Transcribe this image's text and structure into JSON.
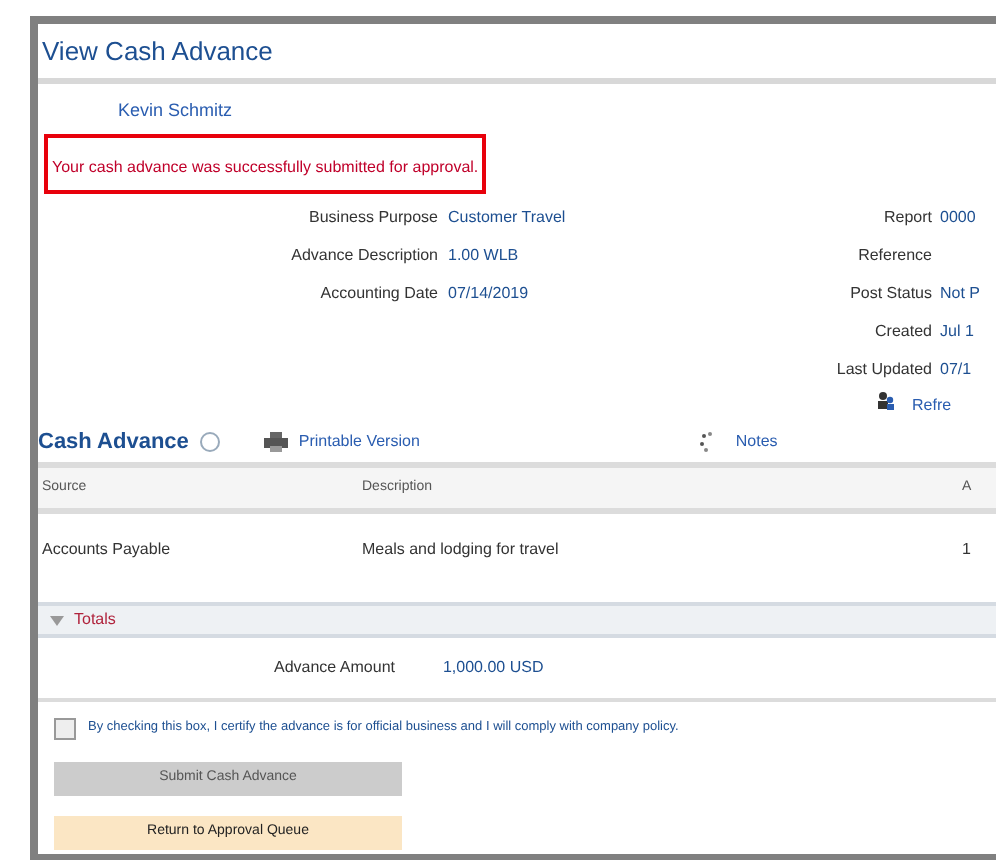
{
  "page_title": "View Cash Advance",
  "employee_link": "Kevin Schmitz",
  "message": "Your cash advance was successfully submitted for approval.",
  "left_fields": [
    {
      "label": "Business Purpose",
      "value": "Customer Travel"
    },
    {
      "label": "Advance Description",
      "value": "1.00 WLB"
    },
    {
      "label": "Accounting Date",
      "value": "07/14/2019"
    }
  ],
  "right_fields": [
    {
      "label": "Report",
      "value": "0000"
    },
    {
      "label": "Reference"
    },
    {
      "label": "Post Status",
      "value": "Not P"
    },
    {
      "label": "Created",
      "value": "Jul 1"
    },
    {
      "label": "Last Updated",
      "value": "07/1"
    }
  ],
  "refresh_link": "Refre",
  "section": {
    "title": "Cash Advance",
    "print_link": "Printable Version",
    "notes_link": "Notes"
  },
  "table": {
    "columns": [
      "Source",
      "Description",
      "A"
    ],
    "rows": [
      [
        "Accounts Payable",
        "Meals and lodging for travel",
        "1"
      ]
    ]
  },
  "totals": {
    "title": "Totals",
    "expanded": true,
    "label": "Advance Amount",
    "value": "1,000.00 USD"
  },
  "certify": {
    "checked": false,
    "text": "By checking this box, I certify the advance is for official business and I will comply with company policy."
  },
  "buttons": [
    {
      "label": "Submit Cash Advance",
      "disabled": true
    },
    {
      "label": "Return to Approval Queue",
      "disabled": false
    }
  ]
}
